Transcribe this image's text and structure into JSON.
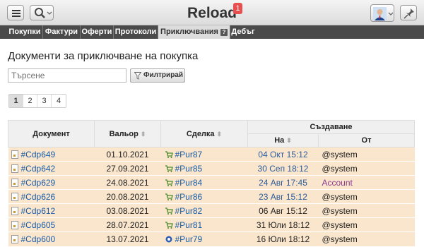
{
  "app": {
    "title": "Reload",
    "notification_count": "1"
  },
  "nav": {
    "tabs": [
      {
        "label": "Покупки"
      },
      {
        "label": "Фактури"
      },
      {
        "label": "Оферти"
      },
      {
        "label": "Протоколи"
      },
      {
        "label": "Приключвания",
        "help": "?"
      },
      {
        "label": "Дебъг"
      }
    ]
  },
  "page": {
    "heading": "Документи за приключване на покупка",
    "search_placeholder": "Търсене",
    "filter_label": "Филтрирай"
  },
  "pager": [
    "1",
    "2",
    "3",
    "4"
  ],
  "table": {
    "headers": {
      "document": "Документ",
      "value_date": "Вальор",
      "deal": "Сделка",
      "created": "Създаване",
      "on": "На",
      "from": "От"
    },
    "rows": [
      {
        "doc": "#Cdp649",
        "value_date": "01.10.2021",
        "deal": "#Pur87",
        "on": "04 Окт 15:12",
        "from": "@system"
      },
      {
        "doc": "#Cdp642",
        "value_date": "27.09.2021",
        "deal": "#Pur85",
        "on": "30 Сеп 18:12",
        "from": "@system"
      },
      {
        "doc": "#Cdp629",
        "value_date": "24.08.2021",
        "deal": "#Pur84",
        "on": "24 Авг 17:45",
        "from": "Account"
      },
      {
        "doc": "#Cdp626",
        "value_date": "20.08.2021",
        "deal": "#Pur86",
        "on": "23 Авг 15:12",
        "from": "@system"
      },
      {
        "doc": "#Cdp612",
        "value_date": "03.08.2021",
        "deal": "#Pur82",
        "on": "06 Авг 15:12",
        "from": "@system"
      },
      {
        "doc": "#Cdp605",
        "value_date": "28.07.2021",
        "deal": "#Pur81",
        "on": "31 Юли 18:12",
        "from": "@system"
      },
      {
        "doc": "#Cdp600",
        "value_date": "13.07.2021",
        "deal": "#Pur79",
        "on": "16 Юли 18:12",
        "from": "@system"
      }
    ]
  },
  "colors": {
    "row_bg": "#fae6cc",
    "link": "#1a5ba6",
    "badge": "#e8504f",
    "account": "#8b3a8e"
  }
}
